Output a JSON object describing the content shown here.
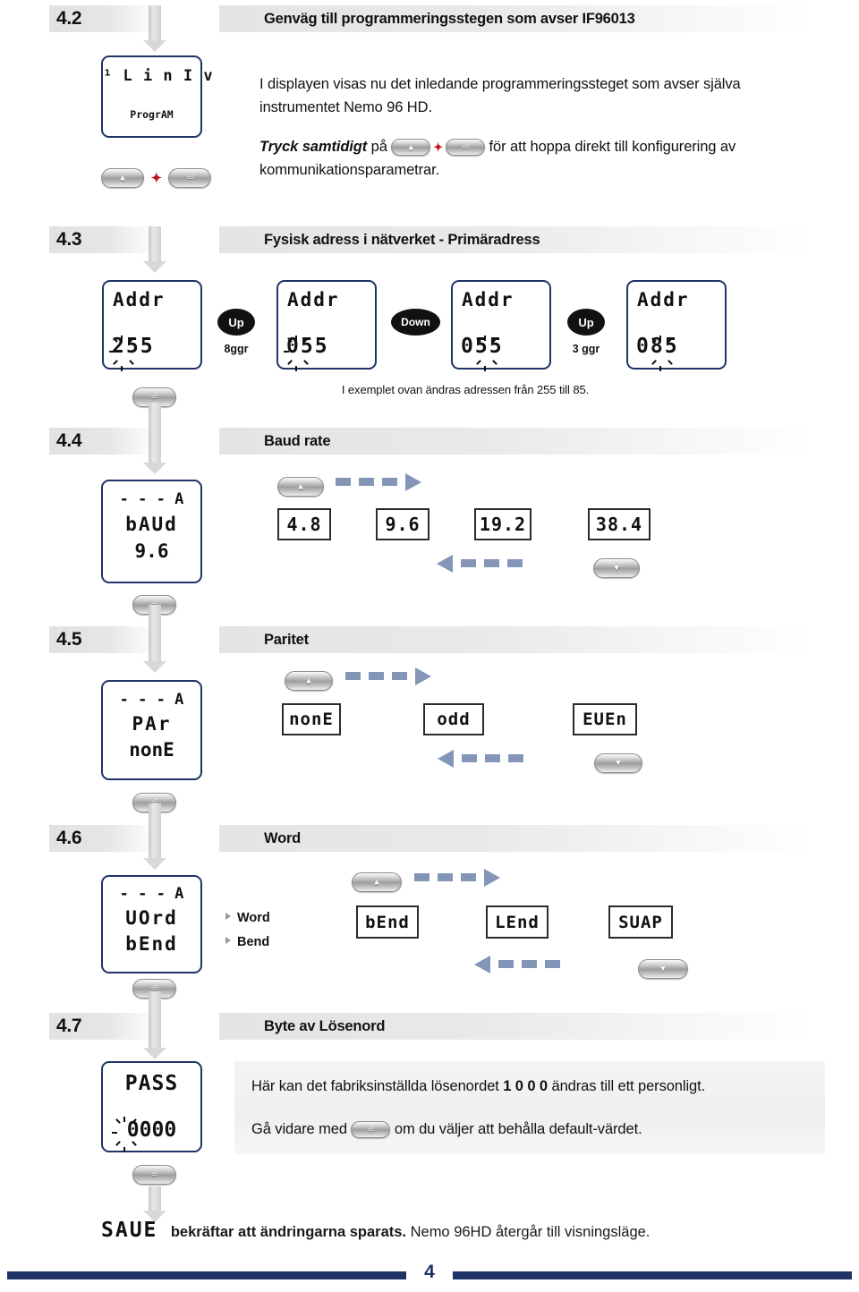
{
  "document": {
    "page_number": "4",
    "language": "sv"
  },
  "sections": [
    {
      "number": "4.2",
      "title": "Genväg till programmeringsstegen  som avser IF96013",
      "lcd": {
        "line1": "¹ L i n I v",
        "line2": "ProgrAM"
      },
      "paragraph1": "I displayen visas nu det inledande programmeringssteget som avser själva instrumentet Nemo 96 HD.",
      "paragraph2_bold": "Tryck samtidigt",
      "paragraph2_mid": " på ",
      "paragraph2_tail": " för att hoppa direkt till konfigurering av kommunikationsparametrar.",
      "buttons": [
        "up-button",
        "enter-button"
      ]
    },
    {
      "number": "4.3",
      "title": "Fysisk adress i nätverket - Primäradress",
      "caption": "I exemplet ovan ändras adressen från 255 till 85.",
      "steps": [
        {
          "lcd_label": "Addr",
          "lcd_value": "255",
          "blink_index": 0
        },
        {
          "lcd_label": "Addr",
          "lcd_value": "055",
          "blink_index": 0
        },
        {
          "lcd_label": "Addr",
          "lcd_value": "055",
          "blink_index": 1
        },
        {
          "lcd_label": "Addr",
          "lcd_value": "085",
          "blink_index": 1
        }
      ],
      "transitions": [
        {
          "label": "Up",
          "count": "8ggr"
        },
        {
          "label": "Down",
          "count": ""
        },
        {
          "label": "Up",
          "count": "3 ggr"
        }
      ]
    },
    {
      "number": "4.4",
      "title": "Baud rate",
      "lcd": {
        "line1": "- - - A",
        "line2": "bAUd",
        "line3": "9.6"
      },
      "options": [
        "4.8",
        "9.6",
        "19.2",
        "38.4"
      ]
    },
    {
      "number": "4.5",
      "title": "Paritet",
      "lcd": {
        "line1": "- - - A",
        "line2": "PAr",
        "line3": "nonE"
      },
      "options": [
        "nonE",
        "odd",
        "EUEn"
      ]
    },
    {
      "number": "4.6",
      "title": "Word",
      "lcd": {
        "line1": "- - - A",
        "line2": "UOrd",
        "line3": "bEnd"
      },
      "labels": [
        "Word",
        "Bend"
      ],
      "options": [
        "bEnd",
        "LEnd",
        "SUAP"
      ]
    },
    {
      "number": "4.7",
      "title": "Byte av Lösenord",
      "lcd": {
        "line1": "PASS",
        "line2": "0000",
        "blink_index": 0
      },
      "info_line1_a": "Här kan det fabriksinställda lösenordet ",
      "info_line1_b": "1 0 0 0",
      "info_line1_c": " ändras till ett personligt.",
      "info_line2_a": "Gå vidare med ",
      "info_line2_b": " om du väljer att behålla default-värdet.",
      "save_seg": "SAUE",
      "save_bold": "bekräftar att ändringarna sparats.",
      "save_rest": " Nemo 96HD återgår till visningsläge."
    }
  ],
  "colors": {
    "brand_navy": "#1f3366",
    "arrow_blue": "#8496b8",
    "accent_red": "#c1121f",
    "header_gray": "#e4e4e4"
  },
  "icons": {
    "up_button": "▲",
    "down_button": "▼",
    "enter_button": "⏎",
    "plus": "✦"
  }
}
